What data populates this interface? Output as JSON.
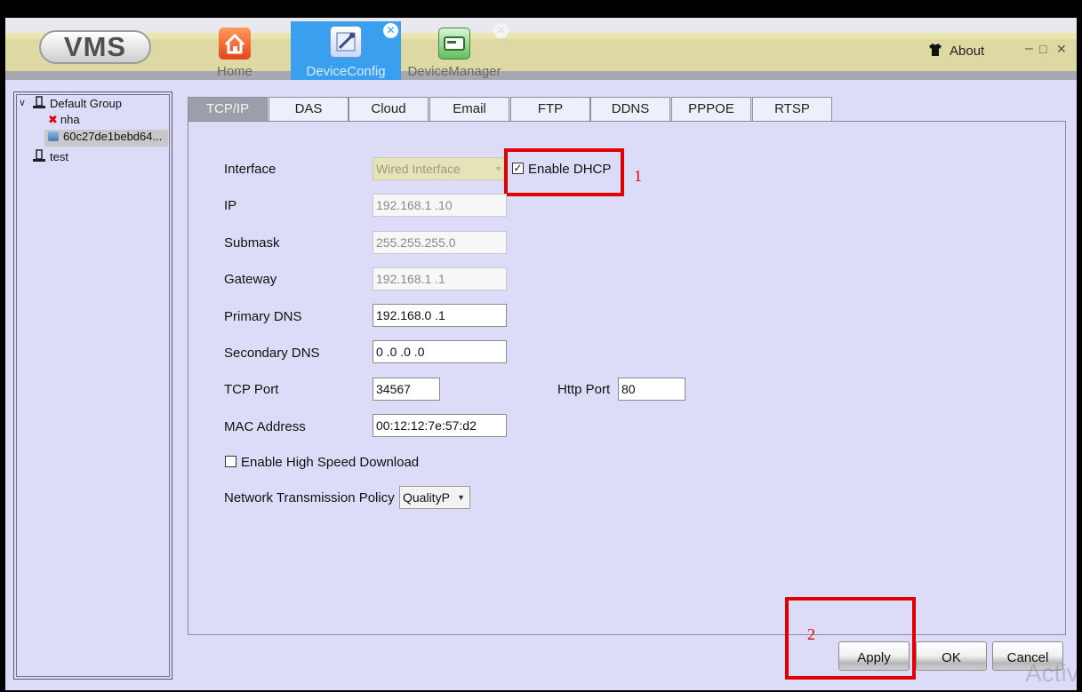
{
  "app": {
    "logo": "VMS"
  },
  "nav": [
    {
      "label": "Home",
      "icon": "home-icon"
    },
    {
      "label": "DeviceConfig",
      "icon": "device-config-icon",
      "active": true
    },
    {
      "label": "DeviceManager",
      "icon": "device-manager-icon"
    }
  ],
  "header": {
    "about": "About",
    "minimize": "–",
    "maximize": "□",
    "close": "✕"
  },
  "tree": {
    "group": "Default Group",
    "children": [
      "nha",
      "60c27de1bebd64..."
    ],
    "other": "test"
  },
  "tabs": [
    "TCP/IP",
    "DAS",
    "Cloud",
    "Email",
    "FTP",
    "DDNS",
    "PPPOE",
    "RTSP"
  ],
  "form": {
    "interface_label": "Interface",
    "interface_value": "Wired Interface",
    "dhcp_label": "Enable DHCP",
    "dhcp_checked": true,
    "ip_label": "IP",
    "ip_value": "192.168.1  .10",
    "submask_label": "Submask",
    "submask_value": "255.255.255.0",
    "gateway_label": "Gateway",
    "gateway_value": "192.168.1  .1",
    "primary_dns_label": "Primary DNS",
    "primary_dns_value": "192.168.0  .1",
    "secondary_dns_label": "Secondary DNS",
    "secondary_dns_value": "0  .0  .0  .0",
    "tcp_port_label": "TCP Port",
    "tcp_port_value": "34567",
    "http_port_label": "Http Port",
    "http_port_value": "80",
    "mac_label": "MAC Address",
    "mac_value": "00:12:12:7e:57:d2",
    "high_speed_label": "Enable High Speed Download",
    "high_speed_checked": false,
    "policy_label": "Network Transmission Policy",
    "policy_value": "QualityP"
  },
  "annotations": {
    "step1": "1",
    "step2": "2"
  },
  "buttons": {
    "apply": "Apply",
    "ok": "OK",
    "cancel": "Cancel"
  },
  "watermark": "Activ",
  "colors": {
    "active_tab": "#3b9ff0",
    "annotation": "#e00000",
    "background": "#dcdcf8"
  }
}
